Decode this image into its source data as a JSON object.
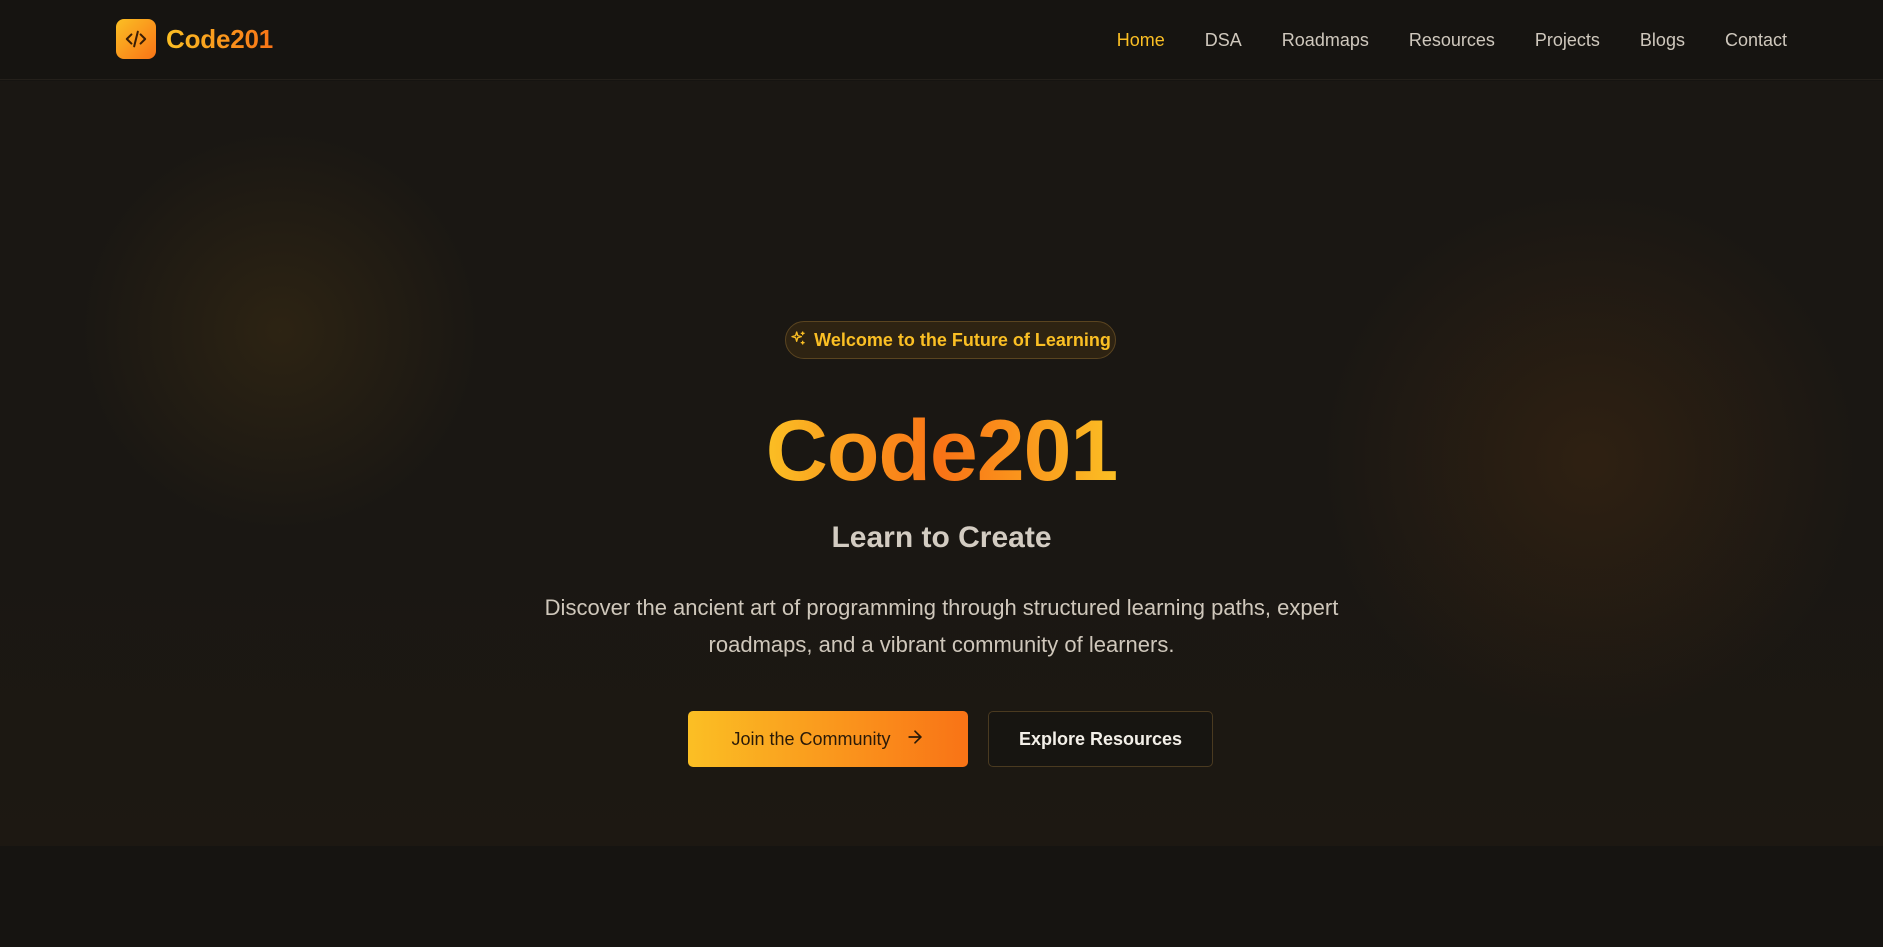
{
  "colors": {
    "background": "#161411",
    "accent_start": "#fbbf24",
    "accent_end": "#f97316",
    "nav_text": "#cfc8bd",
    "nav_active": "#fbbf24"
  },
  "brand": {
    "logo_icon": "code-brackets-icon",
    "name": "Code201"
  },
  "nav": {
    "items": [
      {
        "label": "Home",
        "active": true
      },
      {
        "label": "DSA",
        "active": false
      },
      {
        "label": "Roadmaps",
        "active": false
      },
      {
        "label": "Resources",
        "active": false
      },
      {
        "label": "Projects",
        "active": false
      },
      {
        "label": "Blogs",
        "active": false
      },
      {
        "label": "Contact",
        "active": false
      }
    ]
  },
  "hero": {
    "badge_icon": "sparkles-icon",
    "badge": "Welcome to the Future of Learning",
    "title": "Code201",
    "subtitle": "Learn to Create",
    "description": "Discover the ancient art of programming through structured learning paths, expert roadmaps, and a vibrant community of learners.",
    "primary_button": "Join the Community",
    "primary_button_icon": "arrow-right-icon",
    "secondary_button": "Explore Resources"
  }
}
